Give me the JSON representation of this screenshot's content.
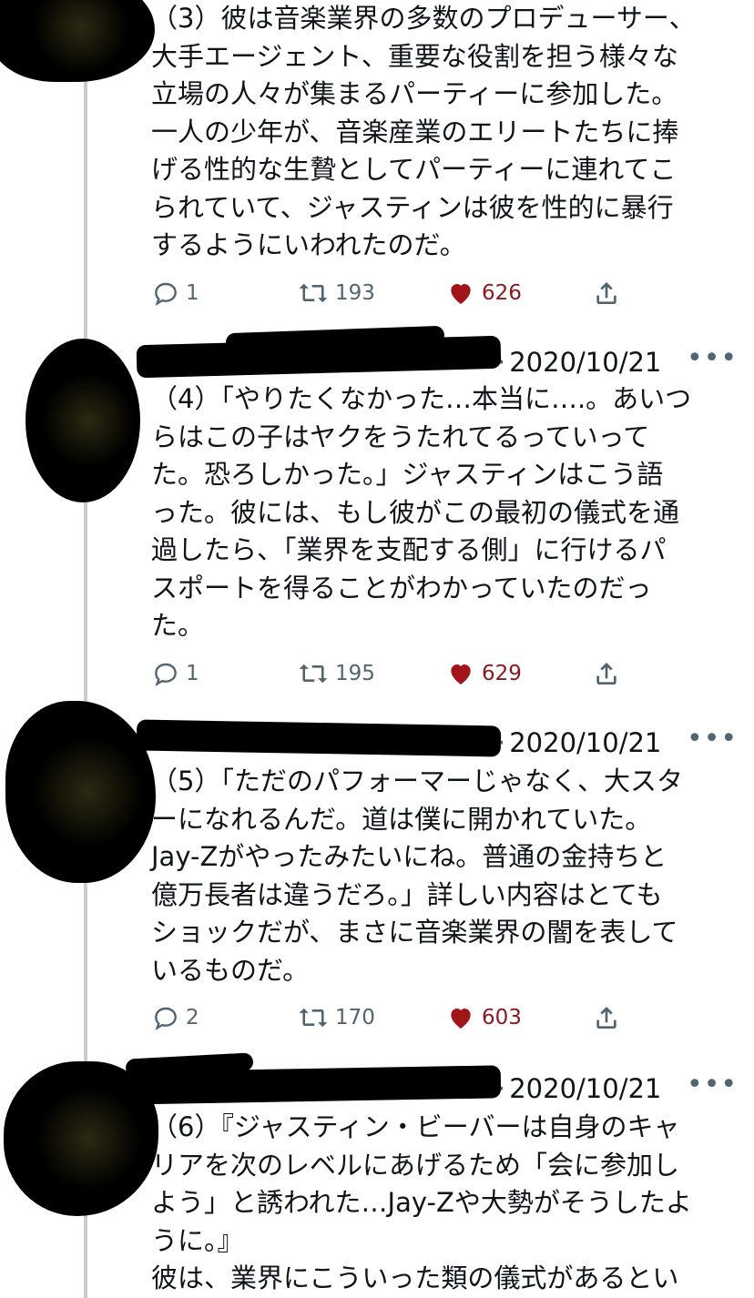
{
  "tweets": [
    {
      "handle": "",
      "date": "",
      "lines": [
        "（3）彼は音楽業界の多数のプロデューサー、",
        "大手エージェント、重要な役割を担う様々な",
        "立場の人々が集まるパーティーに参加した。",
        "一人の少年が、音楽産業のエリートたちに捧",
        "げる性的な生贄としてパーティーに連れてこ",
        "られていて、ジャスティンは彼を性的に暴行",
        "するようにいわれたのだ。"
      ],
      "replies": "1",
      "retweets": "193",
      "likes": "626"
    },
    {
      "handle": "",
      "date": "2020/10/21",
      "lines": [
        "（4）「やりたくなかった…本当に….。あいつ",
        "らはこの子はヤクをうたれてるっていって",
        "た。恐ろしかった。」ジャスティンはこう語",
        "った。彼には、もし彼がこの最初の儀式を通",
        "過したら、「業界を支配する側」に行けるパ",
        "スポートを得ることがわかっていたのだっ",
        "た。"
      ],
      "replies": "1",
      "retweets": "195",
      "likes": "629"
    },
    {
      "handle": "",
      "date": "2020/10/21",
      "lines": [
        "（5）「ただのパフォーマーじゃなく、大スタ",
        "ーになれるんだ。道は僕に開かれていた。",
        "Jay-Zがやったみたいにね。普通の金持ちと",
        "億万長者は違うだろ。」詳しい内容はとても",
        "ショックだが、まさに音楽業界の闇を表して",
        "いるものだ。"
      ],
      "replies": "2",
      "retweets": "170",
      "likes": "603"
    },
    {
      "handle": "",
      "date": "2020/10/21",
      "lines": [
        "（6）『ジャスティン・ビーバーは自身のキャ",
        "リアを次のレベルにあげるため「会に参加し",
        "よう」と誘われた…Jay-Zや大勢がそうしたよ",
        "うに。』",
        "彼は、業界にこういった類の儀式があるとい"
      ],
      "replies": "",
      "retweets": "",
      "likes": ""
    }
  ],
  "ui": {
    "separator_dot": "·",
    "more_glyph": "•••",
    "like_color": "#f91880",
    "icon_color": "#536471",
    "thread_line_color": "#c9cdd1"
  },
  "icons": [
    "reply-icon",
    "retweet-icon",
    "like-icon",
    "share-icon",
    "more-icon"
  ]
}
